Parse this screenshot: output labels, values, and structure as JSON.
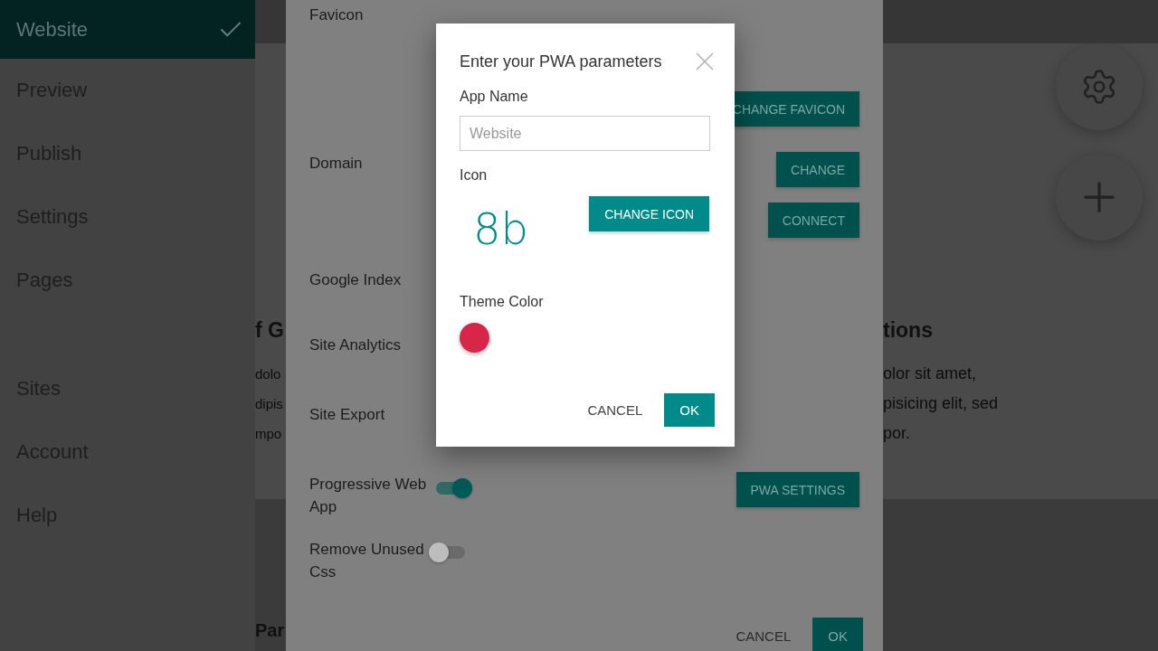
{
  "sidebar": {
    "items": [
      {
        "label": "Website",
        "selected": true
      },
      {
        "label": "Preview",
        "selected": false
      },
      {
        "label": "Publish",
        "selected": false
      },
      {
        "label": "Settings",
        "selected": false
      },
      {
        "label": "Pages",
        "selected": false
      },
      {
        "label": "Sites",
        "selected": false
      },
      {
        "label": "Account",
        "selected": false
      },
      {
        "label": "Help",
        "selected": false
      }
    ]
  },
  "page": {
    "left_strip": {
      "heading": "f G",
      "lines": [
        "dolo",
        "dipis",
        "mpo"
      ],
      "heading_2": "Par"
    },
    "right_strip": {
      "heading": "tions",
      "lines": [
        "olor sit amet,",
        "pisicing elit, sed",
        "por."
      ]
    }
  },
  "settings_panel": {
    "rows": [
      {
        "label": "Favicon",
        "buttons": [
          "CHANGE FAVICON"
        ]
      },
      {
        "label": "Domain",
        "buttons": [
          "CHANGE",
          "CONNECT"
        ]
      },
      {
        "label": "Google Index"
      },
      {
        "label": "Site Analytics"
      },
      {
        "label": "Site Export"
      },
      {
        "label": "Progressive Web App",
        "toggle": {
          "on": true
        },
        "buttons": [
          "PWA SETTINGS"
        ]
      },
      {
        "label": "Remove Unused Css",
        "toggle": {
          "on": false
        }
      }
    ],
    "footer": {
      "cancel": "CANCEL",
      "ok": "OK"
    }
  },
  "dialog": {
    "title": "Enter your PWA parameters",
    "app_name": {
      "label": "App Name",
      "placeholder": "Website"
    },
    "icon": {
      "label": "Icon",
      "preview": "8b",
      "button": "CHANGE ICON"
    },
    "theme_color": {
      "label": "Theme Color",
      "color": "#d7264a"
    },
    "buttons": {
      "cancel": "CANCEL",
      "ok": "OK"
    }
  }
}
